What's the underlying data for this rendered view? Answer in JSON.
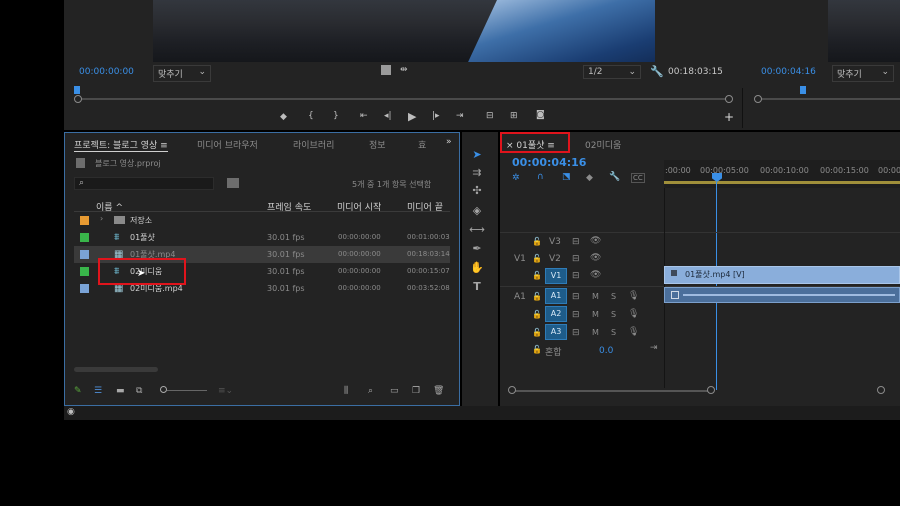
{
  "source_monitor": {
    "timecode": "00:00:00:00",
    "fit_label": "맞추기",
    "resolution": "1/2",
    "duration": "00:18:03:15"
  },
  "program_monitor": {
    "timecode": "00:00:04:16",
    "fit_label": "맞추기"
  },
  "project_panel": {
    "tabs": [
      "프로젝트: 블로그 영상",
      "미디어 브라우저",
      "라이브러리",
      "정보",
      "효"
    ],
    "project_file": "블로그 영상.prproj",
    "selection_status": "5개 중 1개 항목 선택함",
    "columns": [
      "이름",
      "프레임 속도",
      "미디어 시작",
      "미디어 끝"
    ],
    "items": [
      {
        "name": "저장소",
        "fps": "",
        "start": "",
        "end": "",
        "color": "#e79a32",
        "type": "folder-icon"
      },
      {
        "name": "01풀샷",
        "fps": "30.01 fps",
        "start": "00:00:00:00",
        "end": "00:01:00:03",
        "color": "#39b54a",
        "type": "sequence-icon"
      },
      {
        "name": "01풀샷.mp4",
        "fps": "30.01 fps",
        "start": "00:00:00:00",
        "end": "00:18:03:14",
        "color": "#7aa3d6",
        "type": "clip-icon"
      },
      {
        "name": "02미디움",
        "fps": "30.01 fps",
        "start": "00:00:00:00",
        "end": "00:00:15:07",
        "color": "#39b54a",
        "type": "sequence-icon"
      },
      {
        "name": "02미디움.mp4",
        "fps": "30.01 fps",
        "start": "00:00:00:00",
        "end": "00:03:52:08",
        "color": "#7aa3d6",
        "type": "clip-icon"
      }
    ]
  },
  "timeline": {
    "tabs": [
      "01풀샷",
      "02미디움"
    ],
    "timecode": "00:00:04:16",
    "ruler": [
      ":00:00",
      "00:00:05:00",
      "00:00:10:00",
      "00:00:15:00",
      "00:00:"
    ],
    "video_tracks": [
      "V3",
      "V2",
      "V1"
    ],
    "audio_tracks": [
      "A1",
      "A2",
      "A3"
    ],
    "source_patch_video": "V1",
    "source_patch_audio": "A1",
    "mix_label": "혼합",
    "mix_value": "0.0",
    "clip_label": "01풀샷.mp4 [V]",
    "mute_label": "M",
    "solo_label": "S"
  },
  "colors": {
    "accent": "#3a8fe6",
    "highlight": "#e0141c",
    "sequence_green": "#39b54a",
    "clip_blue": "#7aa3d6",
    "folder_orange": "#e79a32"
  }
}
